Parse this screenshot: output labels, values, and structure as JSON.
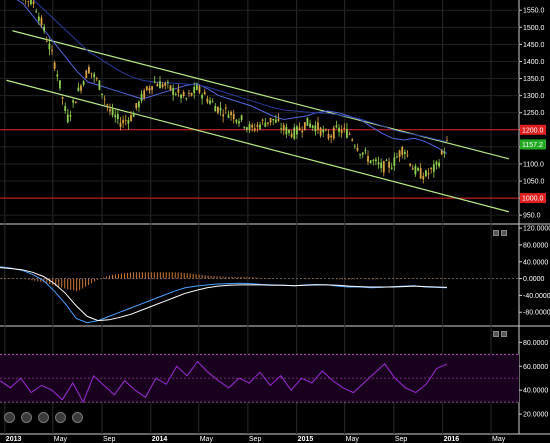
{
  "chart_data": [
    {
      "type": "candlestick",
      "title": "",
      "x_ticks": [
        "2013",
        "May",
        "Sep",
        "2014",
        "May",
        "Sep",
        "2015",
        "May",
        "Sep",
        "2016",
        "May"
      ],
      "y_ticks": [
        "1550.0",
        "1500.0",
        "1450.0",
        "1400.0",
        "1350.0",
        "1300.0",
        "1250.0",
        "1200.0",
        "1150.0",
        "1100.0",
        "1050.0",
        "1000.0",
        "950.0"
      ],
      "ylim": [
        930,
        1580
      ],
      "price_badges": [
        {
          "label": "1200.0",
          "value": 1200,
          "color": "#e02020"
        },
        {
          "label": "1157.2",
          "value": 1157.2,
          "color": "#22aa22"
        },
        {
          "label": "1000.0",
          "value": 1000,
          "color": "#e02020"
        }
      ],
      "horizontal_lines": [
        {
          "value": 1200,
          "color": "#e02020"
        },
        {
          "value": 1000,
          "color": "#e02020"
        }
      ],
      "trend_channel": {
        "upper": [
          {
            "x": "2013-01-20",
            "y": 1490
          },
          {
            "x": "2016-06-15",
            "y": 1115
          }
        ],
        "lower": [
          {
            "x": "2013-01-05",
            "y": 1345
          },
          {
            "x": "2016-06-15",
            "y": 960
          }
        ],
        "color": "#b8e986"
      },
      "series": [
        {
          "name": "",
          "role": "moving-average",
          "color": "#5566dd",
          "values": [
            1590,
            1570,
            1530,
            1490,
            1450,
            1410,
            1370,
            1340,
            1330,
            1320,
            1310,
            1300,
            1290,
            1300,
            1310,
            1320,
            1330,
            1335,
            1320,
            1300,
            1290,
            1280,
            1270,
            1255,
            1240,
            1230,
            1235,
            1240,
            1250,
            1255,
            1250,
            1240,
            1230,
            1210,
            1190,
            1175,
            1170,
            1175,
            1165,
            1150,
            1130
          ]
        },
        {
          "name": "",
          "role": "moving-average",
          "color": "#2a3a9a",
          "values": [
            1620,
            1600,
            1580,
            1550,
            1520,
            1490,
            1460,
            1430,
            1410,
            1390,
            1370,
            1355,
            1345,
            1340,
            1338,
            1336,
            1334,
            1332,
            1325,
            1315,
            1305,
            1295,
            1285,
            1275,
            1265,
            1258,
            1255,
            1252,
            1250,
            1248,
            1244,
            1238,
            1232,
            1222,
            1212,
            1200,
            1192,
            1186,
            1180,
            1172,
            1165
          ]
        },
        {
          "name": "",
          "role": "close-approx",
          "values": [
            1660,
            1620,
            1590,
            1570,
            1480,
            1380,
            1230,
            1310,
            1380,
            1330,
            1250,
            1220,
            1240,
            1300,
            1340,
            1330,
            1310,
            1290,
            1320,
            1290,
            1260,
            1250,
            1230,
            1200,
            1220,
            1230,
            1200,
            1190,
            1220,
            1210,
            1180,
            1200,
            1190,
            1140,
            1110,
            1090,
            1100,
            1150,
            1080,
            1065,
            1090,
            1160
          ]
        }
      ]
    },
    {
      "type": "line",
      "title": "",
      "y_ticks": [
        "120.0000",
        "80.0000",
        "40.0000",
        "0.0000",
        "-40.0000",
        "-80.0000"
      ],
      "ylim": [
        -108,
        125
      ],
      "zero_line": 0,
      "series": [
        {
          "name": "",
          "role": "macd",
          "color": "#4aa0ff",
          "values": [
            28,
            25,
            20,
            10,
            -5,
            -30,
            -60,
            -95,
            -105,
            -100,
            -90,
            -80,
            -70,
            -60,
            -50,
            -40,
            -30,
            -22,
            -18,
            -15,
            -13,
            -12,
            -11,
            -12,
            -14,
            -15,
            -16,
            -17,
            -15,
            -14,
            -15,
            -18,
            -20,
            -20,
            -22,
            -21,
            -19,
            -18,
            -17,
            -20,
            -21,
            -22
          ]
        },
        {
          "name": "",
          "role": "signal",
          "color": "#ffffff",
          "values": [
            26,
            24,
            21,
            15,
            5,
            -12,
            -35,
            -65,
            -90,
            -100,
            -98,
            -92,
            -85,
            -75,
            -65,
            -55,
            -45,
            -35,
            -28,
            -22,
            -18,
            -16,
            -15,
            -15,
            -15,
            -16,
            -16,
            -17,
            -16,
            -15,
            -15,
            -16,
            -18,
            -19,
            -20,
            -20,
            -20,
            -19,
            -18,
            -19,
            -20,
            -21
          ]
        },
        {
          "name": "",
          "role": "histogram",
          "color": "#cc7733",
          "values": [
            2,
            1,
            -1,
            -5,
            -10,
            -18,
            -25,
            -30,
            -15,
            0,
            8,
            12,
            15,
            15,
            15,
            15,
            15,
            13,
            10,
            7,
            5,
            4,
            4,
            3,
            1,
            1,
            0,
            0,
            1,
            1,
            0,
            -2,
            -2,
            -1,
            -2,
            -1,
            1,
            1,
            1,
            -1,
            -1,
            -1
          ]
        }
      ]
    },
    {
      "type": "line",
      "title": "",
      "y_ticks": [
        "80.0000",
        "60.0000",
        "40.0000",
        "20.0000"
      ],
      "ylim": [
        5,
        92
      ],
      "bands": [
        {
          "value": 70,
          "color": "#cc66cc"
        },
        {
          "value": 50,
          "color": "#8a2a8a"
        },
        {
          "value": 30,
          "color": "#cc66cc"
        }
      ],
      "series": [
        {
          "name": "",
          "role": "oscillator",
          "color": "#9a2ad6",
          "values": [
            48,
            42,
            50,
            38,
            44,
            40,
            32,
            46,
            30,
            52,
            44,
            36,
            48,
            40,
            34,
            50,
            45,
            60,
            52,
            64,
            55,
            48,
            42,
            50,
            46,
            55,
            44,
            52,
            40,
            50,
            46,
            56,
            48,
            42,
            38,
            46,
            54,
            62,
            50,
            42,
            38,
            45,
            58,
            62
          ]
        }
      ]
    }
  ],
  "toolbar": {
    "panel_buttons": [
      "",
      ""
    ],
    "circle_buttons": [
      "",
      "",
      "",
      "",
      ""
    ]
  }
}
